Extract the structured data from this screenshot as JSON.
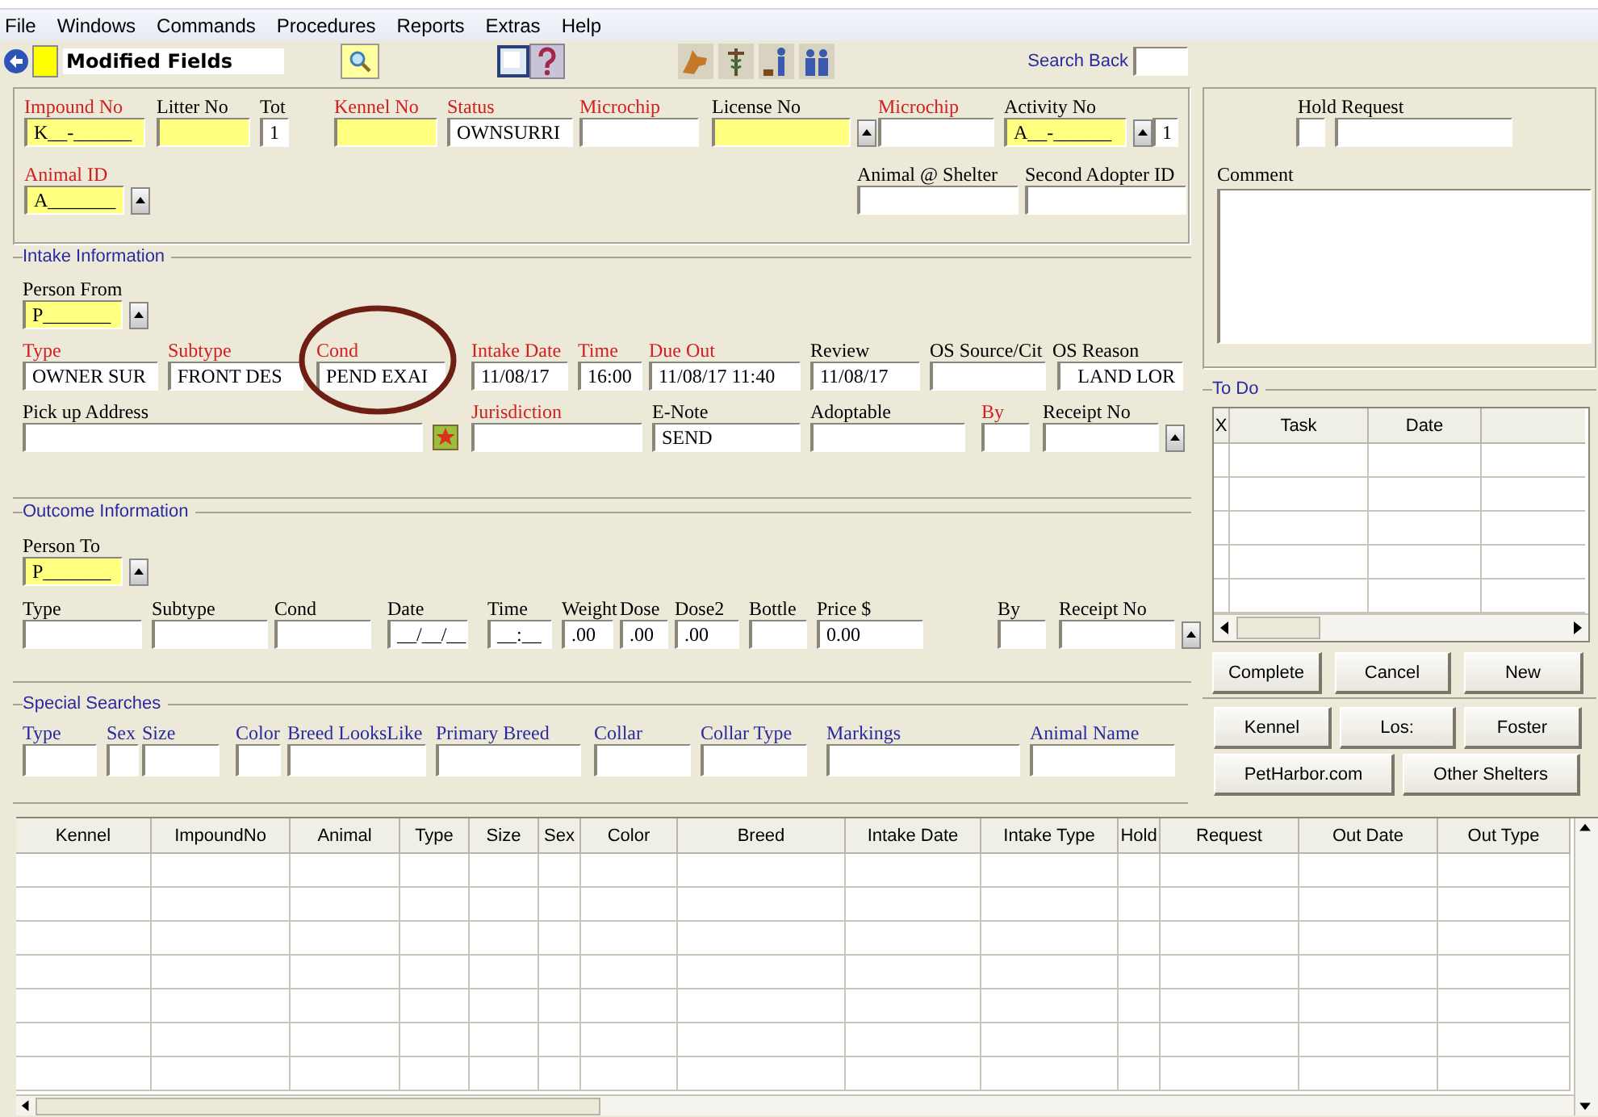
{
  "menu": [
    "File",
    "Windows",
    "Commands",
    "Procedures",
    "Reports",
    "Extras",
    "Help"
  ],
  "toolbar": {
    "legend": "Modified Fields",
    "search_back": "Search Back"
  },
  "header": {
    "rows": [
      {
        "fields": [
          {
            "label": "Impound No",
            "required": true,
            "modified": true,
            "spinner": false,
            "value": "K__-______"
          },
          {
            "label": "Litter No",
            "required": false,
            "modified": true,
            "spinner": false
          },
          {
            "label": "Tot",
            "required": false,
            "modified": false,
            "spinner": false,
            "value": "1"
          },
          {
            "label": "Kennel No",
            "required": true,
            "modified": true,
            "spinner": false
          },
          {
            "label": "Status",
            "required": true,
            "modified": false,
            "spinner": false,
            "value": "OWNSURRI"
          },
          {
            "label": "Microchip",
            "required": true,
            "modified": false,
            "spinner": false
          },
          {
            "label": "License No",
            "required": false,
            "modified": true,
            "spinner": true
          },
          {
            "label": "Microchip",
            "required": true,
            "modified": false,
            "spinner": false
          },
          {
            "label": "Activity No",
            "required": false,
            "modified": true,
            "spinner": true,
            "value": "A__-______"
          },
          {
            "modified": false,
            "spinner": false,
            "value": "1"
          }
        ]
      },
      {
        "fields": [
          {
            "label": "Animal ID",
            "required": true,
            "modified": true,
            "spinner": true,
            "value": "A_______"
          },
          {
            "label": "Animal @ Shelter",
            "required": false,
            "modified": false,
            "spinner": false
          },
          {
            "label": "Second Adopter ID",
            "required": false,
            "modified": false,
            "spinner": false
          }
        ]
      }
    ]
  },
  "hold": {
    "label": "Hold Request"
  },
  "comment": {
    "label": "Comment"
  },
  "intake": {
    "title": "Intake Information",
    "rows": [
      {
        "fields": [
          {
            "label": "Person From",
            "required": false,
            "modified": true,
            "spinner": true,
            "lookup": false,
            "circled": false,
            "value": "P_______"
          }
        ]
      },
      {
        "fields": [
          {
            "label": "Type",
            "required": true,
            "modified": false,
            "spinner": false,
            "lookup": false,
            "circled": false,
            "value": "OWNER SUR"
          },
          {
            "label": "Subtype",
            "required": true,
            "modified": false,
            "spinner": false,
            "lookup": false,
            "circled": false,
            "value": "FRONT DES"
          },
          {
            "label": "Cond",
            "required": true,
            "modified": false,
            "spinner": false,
            "lookup": false,
            "circled": true,
            "value": "PEND EXAI"
          },
          {
            "label": "Intake Date",
            "required": true,
            "modified": false,
            "spinner": false,
            "lookup": false,
            "circled": false,
            "value": "11/08/17"
          },
          {
            "label": "Time",
            "required": true,
            "modified": false,
            "spinner": false,
            "lookup": false,
            "circled": false,
            "value": "16:00"
          },
          {
            "label": "Due Out",
            "required": true,
            "modified": false,
            "spinner": false,
            "lookup": false,
            "circled": false,
            "value": "11/08/17 11:40"
          },
          {
            "label": "Review",
            "required": false,
            "modified": false,
            "spinner": false,
            "lookup": false,
            "circled": false,
            "value": "11/08/17"
          },
          {
            "label": "OS Source/Cit",
            "required": false,
            "modified": false,
            "spinner": false,
            "lookup": false,
            "circled": false
          },
          {
            "label": "OS Reason",
            "required": false,
            "modified": false,
            "spinner": false,
            "lookup": false,
            "circled": false,
            "value": "LAND LOR"
          }
        ]
      },
      {
        "fields": [
          {
            "label": "Pick up Address",
            "required": false,
            "modified": false,
            "spinner": false,
            "lookup": true,
            "circled": false
          },
          {
            "label": "Jurisdiction",
            "required": true,
            "modified": false,
            "spinner": false,
            "lookup": false,
            "circled": false
          },
          {
            "label": "E-Note",
            "required": false,
            "modified": false,
            "spinner": false,
            "lookup": false,
            "circled": false,
            "value": "SEND"
          },
          {
            "label": "Adoptable",
            "required": false,
            "modified": false,
            "spinner": false,
            "lookup": false,
            "circled": false
          },
          {
            "label": "By",
            "required": true,
            "modified": false,
            "spinner": false,
            "lookup": false,
            "circled": false
          },
          {
            "label": "Receipt No",
            "required": false,
            "modified": false,
            "spinner": true,
            "lookup": false,
            "circled": false
          }
        ]
      }
    ]
  },
  "outcome": {
    "title": "Outcome Information",
    "rows": [
      {
        "fields": [
          {
            "label": "Person To",
            "required": false,
            "modified": true,
            "spinner": true,
            "value": "P_______"
          }
        ]
      },
      {
        "fields": [
          {
            "label": "Type",
            "required": false,
            "modified": false,
            "spinner": false
          },
          {
            "label": "Subtype",
            "required": false,
            "modified": false,
            "spinner": false
          },
          {
            "label": "Cond",
            "required": false,
            "modified": false,
            "spinner": false
          },
          {
            "label": "Date",
            "required": false,
            "modified": false,
            "spinner": false,
            "value": "__/__/__"
          },
          {
            "label": "Time",
            "required": false,
            "modified": false,
            "spinner": false,
            "value": "__:__"
          },
          {
            "label": "Weight",
            "required": false,
            "modified": false,
            "spinner": false,
            "value": ".00"
          },
          {
            "label": "Dose",
            "required": false,
            "modified": false,
            "spinner": false,
            "value": ".00"
          },
          {
            "label": "Dose2",
            "required": false,
            "modified": false,
            "spinner": false,
            "value": ".00"
          },
          {
            "label": "Bottle",
            "required": false,
            "modified": false,
            "spinner": false
          },
          {
            "label": "Price $",
            "required": false,
            "modified": false,
            "spinner": false,
            "value": "0.00"
          },
          {
            "label": "By",
            "required": false,
            "modified": false,
            "spinner": false
          },
          {
            "label": "Receipt No",
            "required": false,
            "modified": false,
            "spinner": true
          }
        ]
      }
    ]
  },
  "todo": {
    "title": "To Do",
    "columns": [
      "X",
      "Task",
      "Date"
    ],
    "buttons": [
      "Complete",
      "Cancel",
      "New"
    ]
  },
  "special": {
    "title": "Special Searches",
    "fields": [
      {
        "label": "Type"
      },
      {
        "label": "Sex"
      },
      {
        "label": "Size"
      },
      {
        "label": "Color"
      },
      {
        "label": "Breed LooksLike"
      },
      {
        "label": "Primary Breed"
      },
      {
        "label": "Collar"
      },
      {
        "label": "Collar Type"
      },
      {
        "label": "Markings"
      },
      {
        "label": "Animal Name"
      }
    ],
    "buttons": [
      [
        "Kennel",
        "Los:",
        "Foster"
      ],
      [
        "PetHarbor.com",
        "Other Shelters"
      ]
    ]
  },
  "grid": {
    "columns": [
      "Kennel",
      "ImpoundNo",
      "Animal",
      "Type",
      "Size",
      "Sex",
      "Color",
      "Breed",
      "Intake Date",
      "Intake Type",
      "Hold",
      "Request",
      "Out Date",
      "Out Type"
    ]
  }
}
